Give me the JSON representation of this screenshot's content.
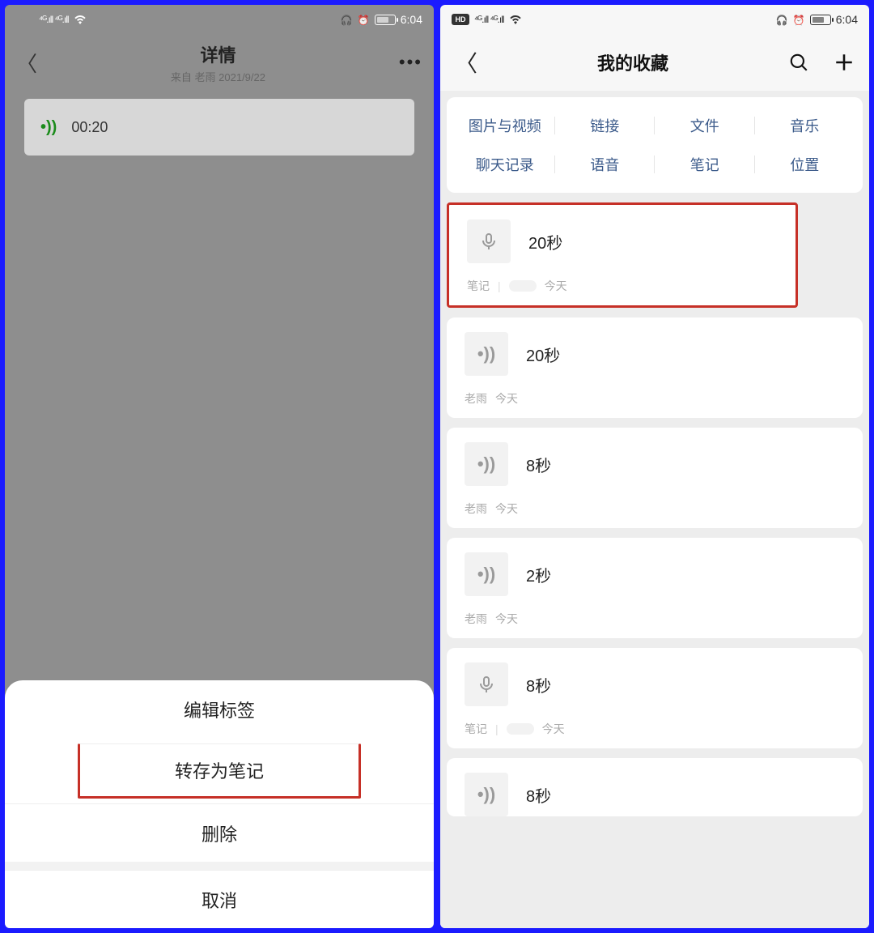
{
  "status": {
    "time": "6:04",
    "signal": "⁴ᴳ.ıll ⁴ᴳ.ıll"
  },
  "left": {
    "title": "详情",
    "subtitle": "来自 老雨 2021/9/22",
    "voice_duration": "00:20",
    "sheet": {
      "edit_tag": "编辑标签",
      "save_as_note": "转存为笔记",
      "delete": "删除",
      "cancel": "取消"
    }
  },
  "right": {
    "title": "我的收藏",
    "categories": {
      "row1": [
        "图片与视频",
        "链接",
        "文件",
        "音乐"
      ],
      "row2": [
        "聊天记录",
        "语音",
        "笔记",
        "位置"
      ]
    },
    "items": [
      {
        "icon": "mic",
        "title": "20秒",
        "meta_left": "笔记",
        "meta_right": "今天",
        "blurred": true,
        "highlight": true
      },
      {
        "icon": "sound",
        "title": "20秒",
        "meta_left": "老雨",
        "meta_right": "今天"
      },
      {
        "icon": "sound",
        "title": "8秒",
        "meta_left": "老雨",
        "meta_right": "今天"
      },
      {
        "icon": "sound",
        "title": "2秒",
        "meta_left": "老雨",
        "meta_right": "今天"
      },
      {
        "icon": "mic",
        "title": "8秒",
        "meta_left": "笔记",
        "meta_right": "今天",
        "blurred": true
      },
      {
        "icon": "sound",
        "title": "8秒",
        "meta_left": "",
        "meta_right": "",
        "partial": true
      }
    ]
  }
}
